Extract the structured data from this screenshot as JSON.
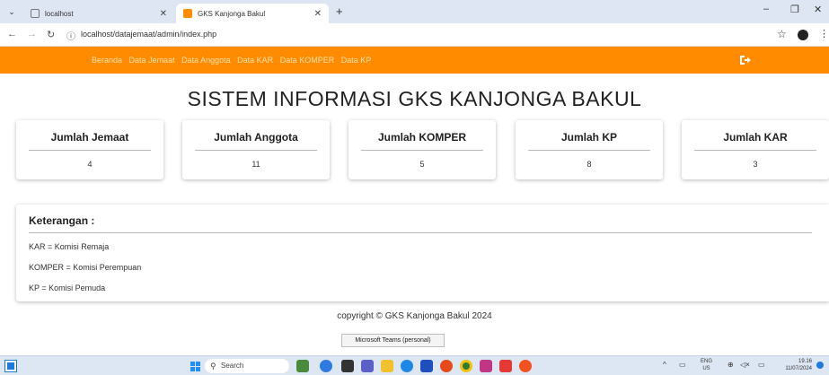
{
  "browser": {
    "tabs": [
      {
        "label": "localhost",
        "active": false
      },
      {
        "label": "GKS Kanjonga Bakul",
        "active": true
      }
    ],
    "url": "localhost/datajemaat/admin/index.php"
  },
  "nav": {
    "links": [
      "Beranda",
      "Data Jemaat",
      "Data Anggota",
      "Data KAR",
      "Data KOMPER",
      "Data KP"
    ],
    "accent_color": "#ff8c00"
  },
  "page": {
    "title": "SISTEM INFORMASI GKS KANJONGA BAKUL"
  },
  "stats": [
    {
      "label": "Jumlah Jemaat",
      "value": "4"
    },
    {
      "label": "Jumlah Anggota",
      "value": "11"
    },
    {
      "label": "Jumlah KOMPER",
      "value": "5"
    },
    {
      "label": "Jumlah KP",
      "value": "8"
    },
    {
      "label": "Jumlah KAR",
      "value": "3"
    }
  ],
  "keterangan": {
    "title": "Keterangan :",
    "items": [
      "KAR = Komisi Remaja",
      "KOMPER = Komisi Perempuan",
      "KP = Komisi Pemuda"
    ]
  },
  "footer": {
    "copyright": "copyright © GKS Kanjonga Bakul 2024"
  },
  "tooltip": "Microsoft Teams (personal)",
  "taskbar": {
    "search_placeholder": "Search",
    "lang_top": "ENG",
    "lang_bottom": "US",
    "time": "19.16",
    "date": "11/07/2024"
  }
}
